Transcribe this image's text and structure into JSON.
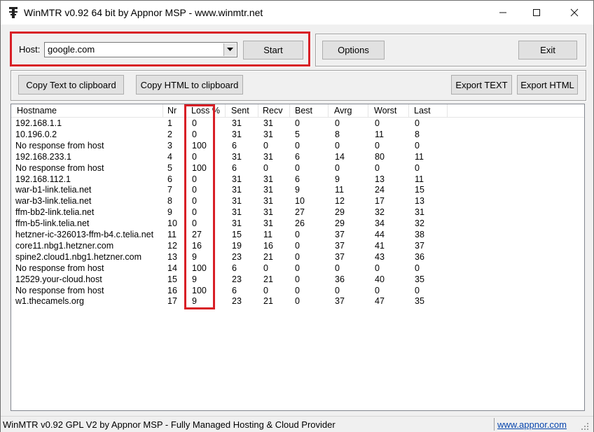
{
  "window": {
    "title": "WinMTR v0.92 64 bit by Appnor MSP - www.winmtr.net"
  },
  "host": {
    "label": "Host:",
    "value": "google.com"
  },
  "buttons": {
    "start": "Start",
    "options": "Options",
    "exit": "Exit",
    "copy_text": "Copy Text to clipboard",
    "copy_html": "Copy HTML to clipboard",
    "export_text": "Export TEXT",
    "export_html": "Export HTML"
  },
  "table": {
    "columns": [
      "Hostname",
      "Nr",
      "Loss %",
      "Sent",
      "Recv",
      "Best",
      "Avrg",
      "Worst",
      "Last"
    ],
    "rows": [
      [
        "192.168.1.1",
        "1",
        "0",
        "31",
        "31",
        "0",
        "0",
        "0",
        "0"
      ],
      [
        "10.196.0.2",
        "2",
        "0",
        "31",
        "31",
        "5",
        "8",
        "11",
        "8"
      ],
      [
        "No response from host",
        "3",
        "100",
        "6",
        "0",
        "0",
        "0",
        "0",
        "0"
      ],
      [
        "192.168.233.1",
        "4",
        "0",
        "31",
        "31",
        "6",
        "14",
        "80",
        "11"
      ],
      [
        "No response from host",
        "5",
        "100",
        "6",
        "0",
        "0",
        "0",
        "0",
        "0"
      ],
      [
        "192.168.112.1",
        "6",
        "0",
        "31",
        "31",
        "6",
        "9",
        "13",
        "11"
      ],
      [
        "war-b1-link.telia.net",
        "7",
        "0",
        "31",
        "31",
        "9",
        "11",
        "24",
        "15"
      ],
      [
        "war-b3-link.telia.net",
        "8",
        "0",
        "31",
        "31",
        "10",
        "12",
        "17",
        "13"
      ],
      [
        "ffm-bb2-link.telia.net",
        "9",
        "0",
        "31",
        "31",
        "27",
        "29",
        "32",
        "31"
      ],
      [
        "ffm-b5-link.telia.net",
        "10",
        "0",
        "31",
        "31",
        "26",
        "29",
        "34",
        "32"
      ],
      [
        "hetzner-ic-326013-ffm-b4.c.telia.net",
        "11",
        "27",
        "15",
        "11",
        "0",
        "37",
        "44",
        "38"
      ],
      [
        "core11.nbg1.hetzner.com",
        "12",
        "16",
        "19",
        "16",
        "0",
        "37",
        "41",
        "37"
      ],
      [
        "spine2.cloud1.nbg1.hetzner.com",
        "13",
        "9",
        "23",
        "21",
        "0",
        "37",
        "43",
        "36"
      ],
      [
        "No response from host",
        "14",
        "100",
        "6",
        "0",
        "0",
        "0",
        "0",
        "0"
      ],
      [
        "12529.your-cloud.host",
        "15",
        "9",
        "23",
        "21",
        "0",
        "36",
        "40",
        "35"
      ],
      [
        "No response from host",
        "16",
        "100",
        "6",
        "0",
        "0",
        "0",
        "0",
        "0"
      ],
      [
        "w1.thecamels.org",
        "17",
        "9",
        "23",
        "21",
        "0",
        "37",
        "47",
        "35"
      ]
    ]
  },
  "status": {
    "text": "WinMTR v0.92 GPL V2 by Appnor MSP - Fully Managed Hosting & Cloud Provider",
    "link": "www.appnor.com"
  },
  "colors": {
    "highlight": "#d81f26",
    "link": "#0645ad"
  },
  "icons": [
    "app-icon",
    "minimize-icon",
    "maximize-icon",
    "close-icon",
    "dropdown-arrow-icon",
    "size-grip-icon"
  ]
}
